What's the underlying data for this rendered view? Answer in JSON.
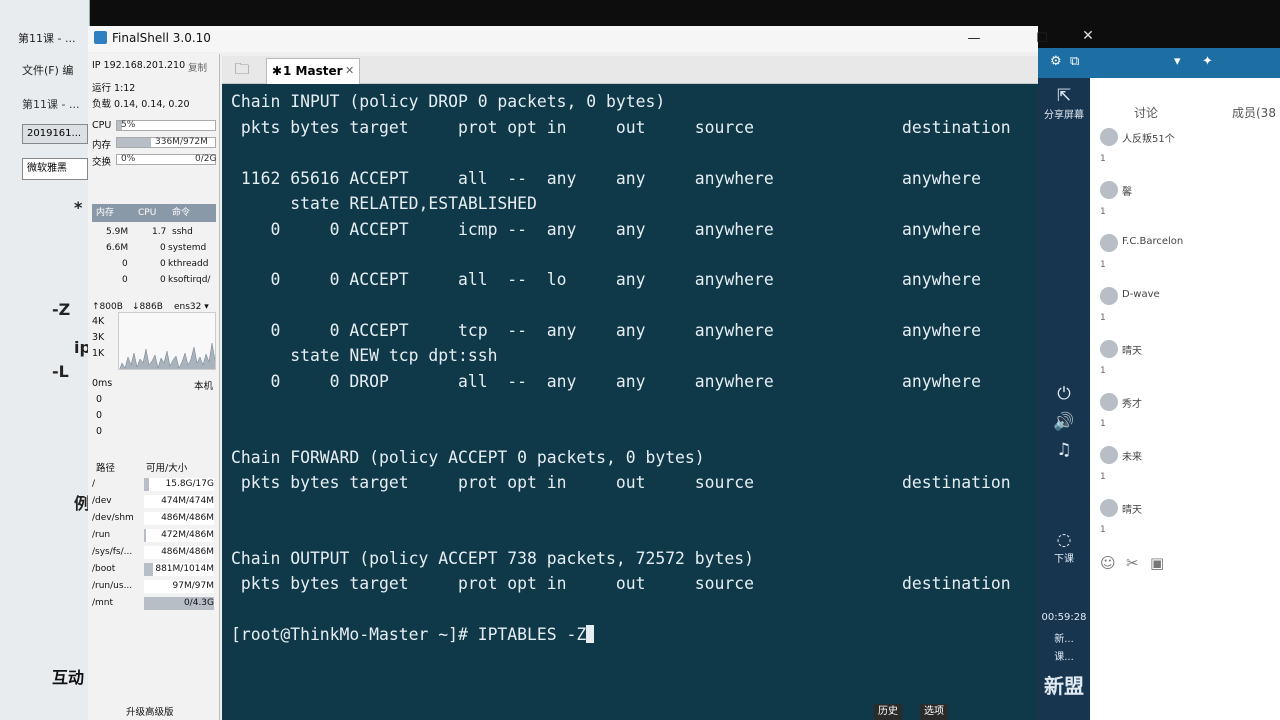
{
  "background_app": {
    "tab_label": "第11课 - ...",
    "menu": "文件(F)  编",
    "lesson": "第11课 - ...",
    "date_box": "2019161...",
    "font_box": "微软雅黑",
    "fragment_1": "*",
    "fragment_2": "-Z",
    "fragment_3": "ip",
    "fragment_4": "-L",
    "fragment_5": "例",
    "interaction": "互动"
  },
  "window": {
    "title": "FinalShell 3.0.10",
    "minimize": "—",
    "maximize": "☐",
    "close": "✕"
  },
  "stats": {
    "ip": "IP 192.168.201.210",
    "copy": "复制",
    "uptime": "运行 1:12",
    "load": "负载 0.14, 0.14, 0.20",
    "cpu_label": "CPU",
    "cpu_value": "5%",
    "cpu_pct": 5,
    "mem_label": "内存",
    "mem_value": "336M/972M",
    "mem_pct": 35,
    "swap_label": "交换",
    "swap_value": "0%",
    "swap_detail": "0/2G",
    "swap_pct": 0,
    "proc_headers": [
      "内存",
      "CPU",
      "命令"
    ],
    "processes": [
      {
        "mem": "5.9M",
        "cpu": "1.7",
        "cmd": "sshd"
      },
      {
        "mem": "6.6M",
        "cpu": "0",
        "cmd": "systemd"
      },
      {
        "mem": "0",
        "cpu": "0",
        "cmd": "kthreadd"
      },
      {
        "mem": "0",
        "cpu": "0",
        "cmd": "ksoftirqd/"
      }
    ],
    "net_up": "↑800B",
    "net_down": "↓886B",
    "net_iface": "ens32 ▾",
    "y_ticks": [
      "4K",
      "3K",
      "1K"
    ],
    "latency_label": "0ms",
    "latency_host": "本机",
    "latency_values": [
      "0",
      "0",
      "0"
    ],
    "disk_header_path": "路径",
    "disk_header_size": "可用/大小",
    "disks": [
      {
        "path": "/",
        "size": "15.8G/17G",
        "used": 7
      },
      {
        "path": "/dev",
        "size": "474M/474M",
        "used": 0
      },
      {
        "path": "/dev/shm",
        "size": "486M/486M",
        "used": 0
      },
      {
        "path": "/run",
        "size": "472M/486M",
        "used": 3
      },
      {
        "path": "/sys/fs/...",
        "size": "486M/486M",
        "used": 0
      },
      {
        "path": "/boot",
        "size": "881M/1014M",
        "used": 13
      },
      {
        "path": "/run/us...",
        "size": "97M/97M",
        "used": 0
      },
      {
        "path": "/mnt",
        "size": "0/4.3G",
        "used": 100
      }
    ],
    "upgrade": "升级高级版"
  },
  "tabs": {
    "active": "1 Master",
    "close": "✕"
  },
  "terminal": {
    "lines": [
      "Chain INPUT (policy DROP 0 packets, 0 bytes)",
      " pkts bytes target     prot opt in     out     source               destination",
      "",
      " 1162 65616 ACCEPT     all  --  any    any     anywhere             anywhere",
      "      state RELATED,ESTABLISHED",
      "    0     0 ACCEPT     icmp --  any    any     anywhere             anywhere",
      "",
      "    0     0 ACCEPT     all  --  lo     any     anywhere             anywhere",
      "",
      "    0     0 ACCEPT     tcp  --  any    any     anywhere             anywhere",
      "      state NEW tcp dpt:ssh",
      "    0     0 DROP       all  --  any    any     anywhere             anywhere",
      "",
      "",
      "Chain FORWARD (policy ACCEPT 0 packets, 0 bytes)",
      " pkts bytes target     prot opt in     out     source               destination",
      "",
      "",
      "Chain OUTPUT (policy ACCEPT 738 packets, 72572 bytes)",
      " pkts bytes target     prot opt in     out     source               destination",
      ""
    ],
    "prompt": "[root@ThinkMo-Master ~]# IPTABLES -Z"
  },
  "bottom_tabs": [
    "历史",
    "选项"
  ],
  "side": {
    "share_screen": "分享屏幕",
    "discussion": "讨论",
    "members": "成员(38",
    "people": [
      {
        "name": "人反叛51个",
        "count": "1"
      },
      {
        "name": "馨",
        "count": "1"
      },
      {
        "name": "F.C.Barcelon",
        "count": "1"
      },
      {
        "name": "D-wave",
        "count": "1"
      },
      {
        "name": "晴天",
        "count": "1"
      },
      {
        "name": "秀才",
        "count": "1"
      },
      {
        "name": "未来",
        "count": "1"
      },
      {
        "name": "晴天",
        "count": "1"
      }
    ],
    "hand_up": "下课",
    "time": "00:59:28",
    "status1": "新...",
    "status2": "课...",
    "brand": "新盟"
  }
}
